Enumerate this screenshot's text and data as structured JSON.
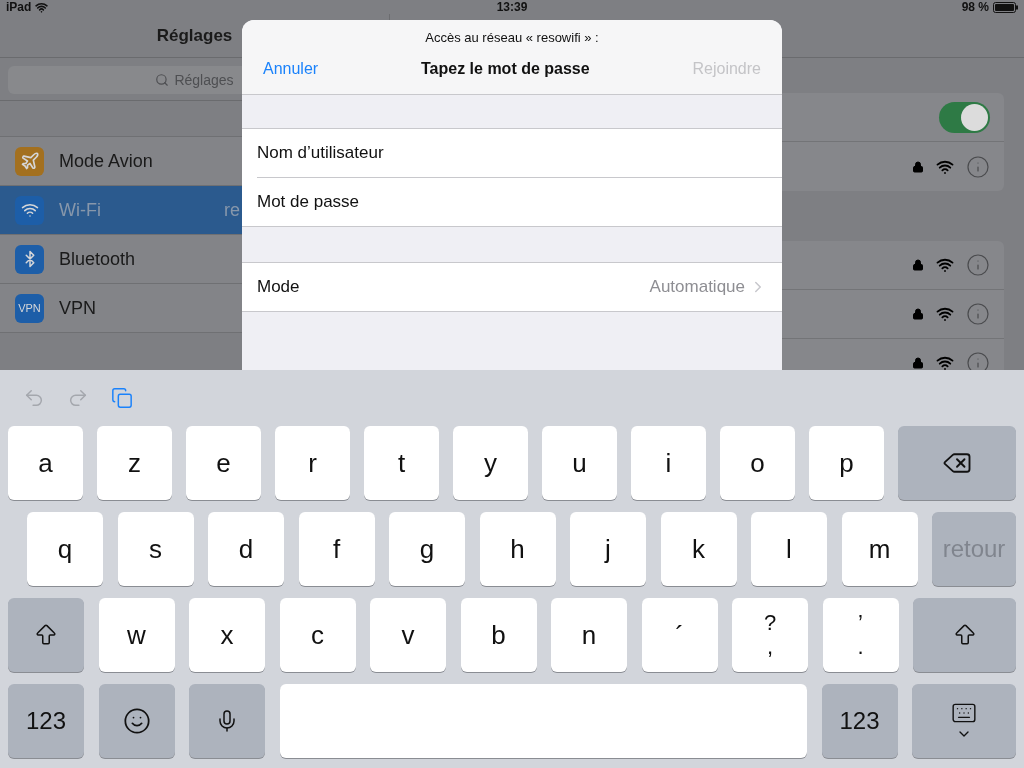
{
  "status_bar": {
    "device": "iPad",
    "time": "13:39",
    "battery": "98 %"
  },
  "sidebar": {
    "title": "Réglages",
    "search": {
      "placeholder": "Réglages"
    },
    "items": [
      {
        "label": "Mode Avion",
        "kind": "airplane",
        "selected": false
      },
      {
        "label": "Wi-Fi",
        "kind": "wifi",
        "selected": true,
        "value": "re"
      },
      {
        "label": "Bluetooth",
        "kind": "bluetooth",
        "selected": false
      },
      {
        "label": "VPN",
        "kind": "vpn",
        "badge": "VPN",
        "selected": false
      }
    ]
  },
  "detail": {
    "wifi_switch": {
      "on": true
    },
    "current_network": {
      "locked": true
    },
    "networks": [
      {
        "locked": true
      },
      {
        "locked": true
      },
      {
        "locked": true
      }
    ]
  },
  "dialog": {
    "subtitle": "Accès au réseau « resowifi » :",
    "title": "Tapez le mot de passe",
    "cancel": "Annuler",
    "join": {
      "label": "Rejoindre",
      "disabled": true
    },
    "fields": [
      {
        "label": "Nom d’utilisateur"
      },
      {
        "label": "Mot de passe"
      }
    ],
    "mode": {
      "label": "Mode",
      "value": "Automatique"
    }
  },
  "keyboard": {
    "toolbar": [
      {
        "kind": "undo",
        "disabled": true
      },
      {
        "kind": "redo",
        "disabled": true
      },
      {
        "kind": "paste",
        "disabled": false
      }
    ],
    "rows": [
      {
        "keys": [
          {
            "kind": "letter",
            "label": "a"
          },
          {
            "kind": "letter",
            "label": "z"
          },
          {
            "kind": "letter",
            "label": "e"
          },
          {
            "kind": "letter",
            "label": "r"
          },
          {
            "kind": "letter",
            "label": "t"
          },
          {
            "kind": "letter",
            "label": "y"
          },
          {
            "kind": "letter",
            "label": "u"
          },
          {
            "kind": "letter",
            "label": "i"
          },
          {
            "kind": "letter",
            "label": "o"
          },
          {
            "kind": "letter",
            "label": "p"
          },
          {
            "kind": "backspace"
          }
        ]
      },
      {
        "keys": [
          {
            "kind": "letter",
            "label": "q"
          },
          {
            "kind": "letter",
            "label": "s"
          },
          {
            "kind": "letter",
            "label": "d"
          },
          {
            "kind": "letter",
            "label": "f"
          },
          {
            "kind": "letter",
            "label": "g"
          },
          {
            "kind": "letter",
            "label": "h"
          },
          {
            "kind": "letter",
            "label": "j"
          },
          {
            "kind": "letter",
            "label": "k"
          },
          {
            "kind": "letter",
            "label": "l"
          },
          {
            "kind": "letter",
            "label": "m"
          },
          {
            "kind": "return",
            "label": "retour",
            "disabled": true
          }
        ]
      },
      {
        "keys": [
          {
            "kind": "shift"
          },
          {
            "kind": "letter",
            "label": "w"
          },
          {
            "kind": "letter",
            "label": "x"
          },
          {
            "kind": "letter",
            "label": "c"
          },
          {
            "kind": "letter",
            "label": "v"
          },
          {
            "kind": "letter",
            "label": "b"
          },
          {
            "kind": "letter",
            "label": "n"
          },
          {
            "kind": "letter",
            "label": "´"
          },
          {
            "kind": "dual",
            "top": "?",
            "bottom": ","
          },
          {
            "kind": "dual",
            "top": "’",
            "bottom": "."
          },
          {
            "kind": "shift"
          }
        ]
      },
      {
        "keys": [
          {
            "kind": "numbers",
            "label": "123"
          },
          {
            "kind": "emoji"
          },
          {
            "kind": "mic"
          },
          {
            "kind": "space"
          },
          {
            "kind": "numbers",
            "label": "123"
          },
          {
            "kind": "dismiss"
          }
        ]
      }
    ]
  }
}
